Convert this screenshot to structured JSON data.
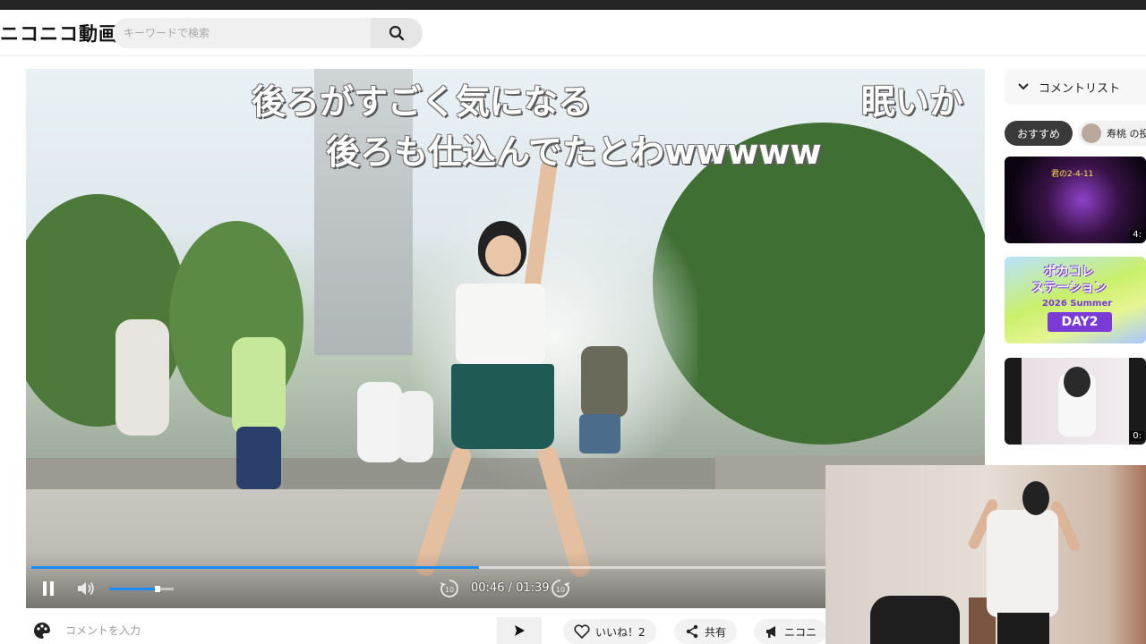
{
  "header": {
    "logo": "ニコニコ動画",
    "search_placeholder": "キーワードで検索"
  },
  "player": {
    "danmaku": [
      "後ろがすごく気になる",
      "後ろも仕込んでたとわwwwww",
      "眠いか"
    ],
    "current_time": "00:46",
    "duration": "01:39",
    "time_display": "00:46 / 01:39",
    "progress": 0.472,
    "volume": 0.75
  },
  "comment_bar": {
    "placeholder": "コメントを入力",
    "like_label": "いいね！2",
    "share_label": "共有",
    "nicoad_label": "ニコニ"
  },
  "sidebar": {
    "comment_list_label": "コメントリスト",
    "recommend_chip": "おすすめ",
    "user_chip": "寿桃 の投",
    "thumbnails": [
      {
        "title": "君の2-4-11",
        "duration": "4:"
      },
      {
        "title": "ボカコレ\nステーション",
        "subtitle": "2026 Summer",
        "badge": "DAY2",
        "duration": ""
      },
      {
        "title": "",
        "duration": "0:"
      }
    ]
  },
  "colors": {
    "accent": "#1a8bf0",
    "header_bg": "#ffffff",
    "top_strip": "#252525",
    "chip_dark": "#3a3a3a"
  }
}
